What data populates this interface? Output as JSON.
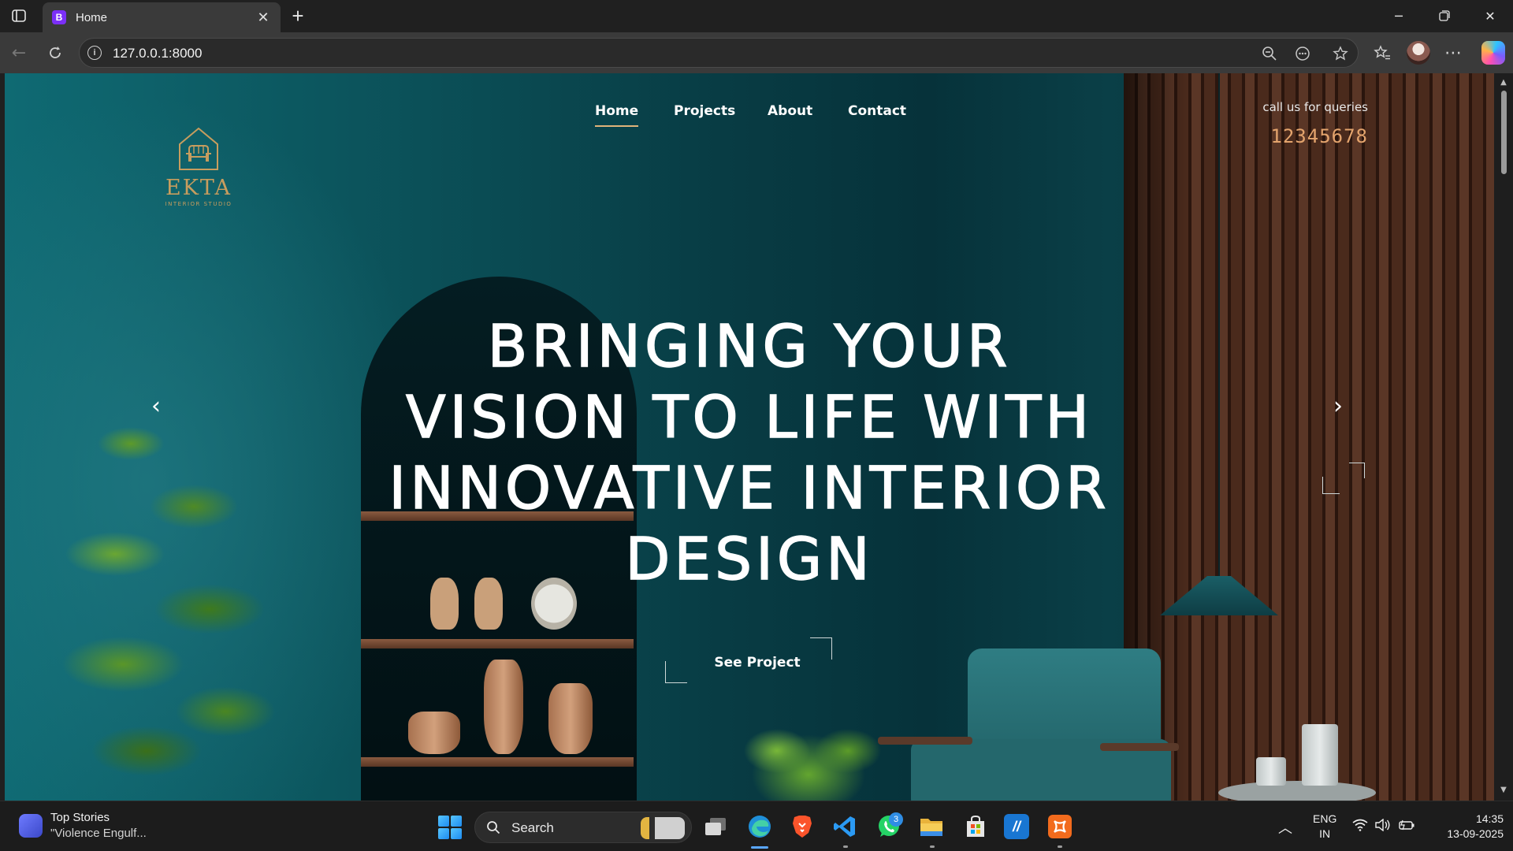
{
  "browser": {
    "tab_title": "Home",
    "tab_favicon_letter": "B",
    "url": "127.0.0.1:8000"
  },
  "site": {
    "logo_name": "EKTA",
    "logo_sub": "INTERIOR STUDIO",
    "nav": [
      {
        "label": "Home",
        "active": true
      },
      {
        "label": "Projects",
        "active": false
      },
      {
        "label": "About",
        "active": false
      },
      {
        "label": "Contact",
        "active": false
      }
    ],
    "call_label": "call us for queries",
    "call_number": "12345678",
    "headline_lines": [
      "BRINGING YOUR",
      "VISION TO LIFE WITH",
      "INNOVATIVE INTERIOR",
      "DESIGN"
    ],
    "cta_label": "See Project",
    "accent_color": "#e0b37a",
    "gold_color": "#c79d5e",
    "phone_color": "#e4a46d"
  },
  "taskbar": {
    "news_title": "Top Stories",
    "news_subtitle": "\"Violence Engulf...",
    "search_label": "Search",
    "whatsapp_badge": "3",
    "lang_line1": "ENG",
    "lang_line2": "IN",
    "time": "14:35",
    "date": "13-09-2025"
  }
}
